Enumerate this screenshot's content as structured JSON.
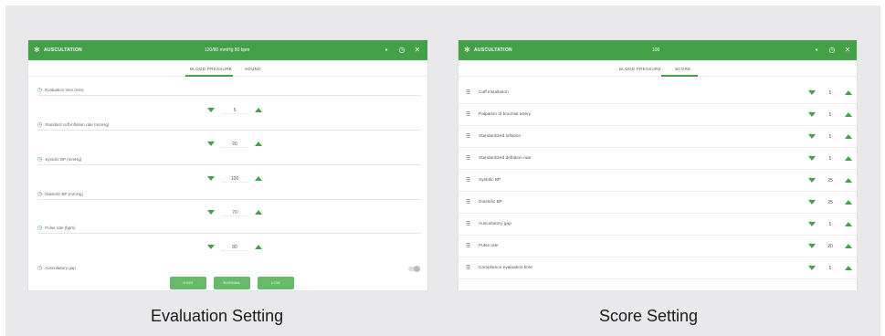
{
  "captions": {
    "left": "Evaluation Setting",
    "right": "Score Setting"
  },
  "colors": {
    "accent": "#43a047",
    "button": "#66bb6a",
    "frame": "#e9e9eb"
  },
  "evaluation": {
    "header": {
      "title": "AUSCULTATION",
      "center_text": "120/80 mmHg 80 bpm"
    },
    "tabs": [
      {
        "label": "BLOOD PRESSURE",
        "active": true
      },
      {
        "label": "SOUND",
        "active": false
      }
    ],
    "rows": [
      {
        "label": "Evaluation time (min)",
        "value": "5"
      },
      {
        "label": "Standard cuff inflation rate (mmHg)",
        "value": "20"
      },
      {
        "label": "Systolic BP (mmHg)",
        "value": "100"
      },
      {
        "label": "Diastolic BP (mmHg)",
        "value": "70"
      },
      {
        "label": "Pulse rate (bpm)",
        "value": "80"
      }
    ],
    "toggle_row": {
      "label": "Auscultatory gap",
      "on": false
    },
    "buttons": [
      "HIGH",
      "NORMAL",
      "LOW"
    ]
  },
  "score": {
    "header": {
      "title": "AUSCULTATION",
      "center_text": "100"
    },
    "tabs": [
      {
        "label": "BLOOD PRESSURE",
        "active": false
      },
      {
        "label": "SCORE",
        "active": true
      }
    ],
    "rows": [
      {
        "label": "Cuff installation",
        "value": "5"
      },
      {
        "label": "Palpation of brachial artery",
        "value": "5"
      },
      {
        "label": "Standardized inflation",
        "value": "5"
      },
      {
        "label": "Standardized deflation rate",
        "value": "5"
      },
      {
        "label": "Systolic BP",
        "value": "25"
      },
      {
        "label": "Diastolic BP",
        "value": "25"
      },
      {
        "label": "Auscultatory gap",
        "value": "5"
      },
      {
        "label": "Pulse rate",
        "value": "20"
      },
      {
        "label": "Compliance evaluation time",
        "value": "5"
      }
    ]
  }
}
